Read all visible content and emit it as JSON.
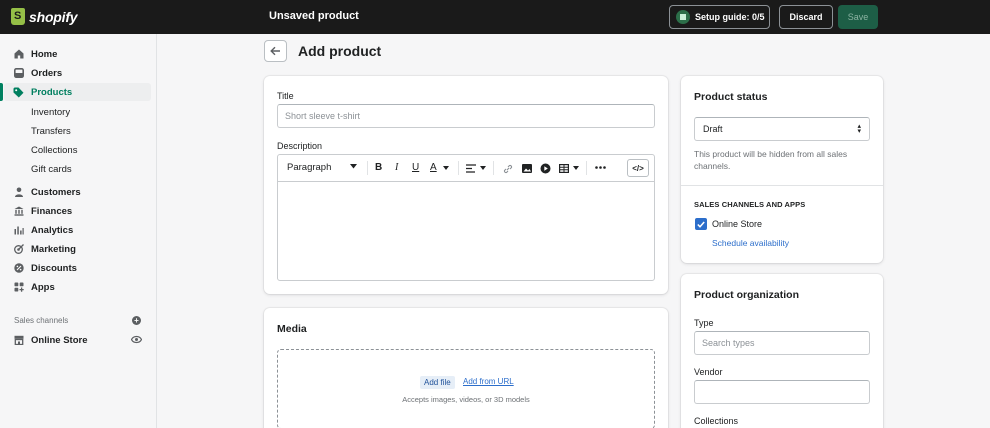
{
  "topbar": {
    "logo_text": "shopify",
    "title": "Unsaved product",
    "setup_guide": "Setup guide: 0/5",
    "discard": "Discard",
    "save": "Save"
  },
  "sidebar": {
    "items": [
      {
        "label": "Home",
        "icon": "home-icon"
      },
      {
        "label": "Orders",
        "icon": "orders-icon"
      },
      {
        "label": "Products",
        "icon": "tag-icon",
        "active": true
      },
      {
        "label": "Customers",
        "icon": "person-icon"
      },
      {
        "label": "Finances",
        "icon": "bank-icon"
      },
      {
        "label": "Analytics",
        "icon": "bar-chart-icon"
      },
      {
        "label": "Marketing",
        "icon": "target-icon"
      },
      {
        "label": "Discounts",
        "icon": "discount-icon"
      },
      {
        "label": "Apps",
        "icon": "apps-icon"
      }
    ],
    "product_subitems": [
      "Inventory",
      "Transfers",
      "Collections",
      "Gift cards"
    ],
    "sales_channels_label": "Sales channels",
    "online_store": "Online Store"
  },
  "page": {
    "title": "Add product"
  },
  "product_form": {
    "title_label": "Title",
    "title_placeholder": "Short sleeve t-shirt",
    "description_label": "Description",
    "paragraph_select": "Paragraph"
  },
  "media": {
    "title": "Media",
    "add_file": "Add file",
    "add_from_url": "Add from URL",
    "accepts": "Accepts images, videos, or 3D models"
  },
  "status": {
    "title": "Product status",
    "value": "Draft",
    "help": "This product will be hidden from all sales channels.",
    "channels_label": "SALES CHANNELS AND APPS",
    "online_store": "Online Store",
    "online_store_checked": true,
    "schedule": "Schedule availability"
  },
  "organization": {
    "title": "Product organization",
    "type_label": "Type",
    "type_placeholder": "Search types",
    "vendor_label": "Vendor",
    "collections_label": "Collections"
  },
  "colors": {
    "topbar": "#1a1a1a",
    "accent_green": "#008060",
    "link_blue": "#2c6ecb"
  }
}
